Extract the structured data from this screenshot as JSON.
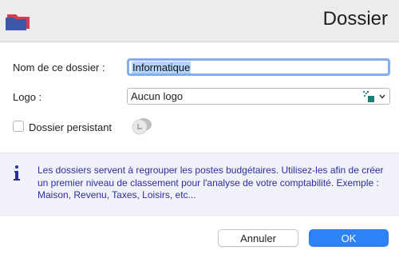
{
  "window": {
    "title": "Dossier",
    "app_icon": "folder-icon"
  },
  "form": {
    "name_label": "Nom de ce dossier :",
    "name_value": "Informatique",
    "logo_label": "Logo :",
    "logo_value": "Aucun logo",
    "logo_icon": "logo-placeholder-icon",
    "persistent_label": "Dossier persistant",
    "persistent_checked": false,
    "toggle_icon": "toggle-icon"
  },
  "info": {
    "icon": "info-icon",
    "text": "Les dossiers servent à regrouper les postes budgétaires. Utilisez-les afin de créer un premier niveau de classement pour l'analyse de votre comptabilité. Exemple : Maison, Revenu, Taxes, Loisirs, etc..."
  },
  "buttons": {
    "cancel": "Annuler",
    "ok": "OK"
  },
  "colors": {
    "accent": "#2d83f5",
    "info_text": "#2b2f9c",
    "selection": "#b5d4fb"
  }
}
